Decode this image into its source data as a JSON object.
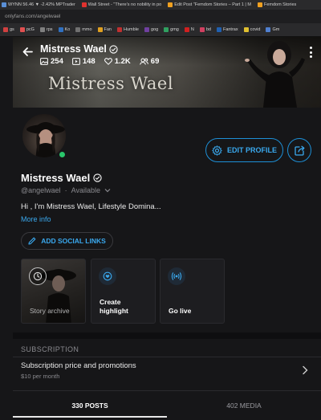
{
  "browser": {
    "tabs": [
      {
        "label": "WYNN 56.46 ▼ -2.42% MPTrader",
        "color": "#5a8fd6"
      },
      {
        "label": "Wall Street - \"There's no nobility in po",
        "color": "#e0322f"
      },
      {
        "label": "Edit Post \"Femdom Stories – Part 1 | M",
        "color": "#f0a020"
      },
      {
        "label": "Femdom Stories",
        "color": "#f0a020"
      }
    ],
    "url": "onlyfans.com/angelwael",
    "bookmarks": [
      {
        "label": "gs",
        "color": "#d04040"
      },
      {
        "label": "pcG",
        "color": "#e05050"
      },
      {
        "label": "rps",
        "color": "#808080"
      },
      {
        "label": "Ko",
        "color": "#3070c0"
      },
      {
        "label": "mmo",
        "color": "#707070"
      },
      {
        "label": "Fan",
        "color": "#e0a020"
      },
      {
        "label": "Humble",
        "color": "#c03030"
      },
      {
        "label": "gog",
        "color": "#7040a0"
      },
      {
        "label": "gmg",
        "color": "#30a060"
      },
      {
        "label": "N",
        "color": "#d02020"
      },
      {
        "label": "bd",
        "color": "#d04060"
      },
      {
        "label": "Fantrax",
        "color": "#2060b0"
      },
      {
        "label": "covid",
        "color": "#e0c030"
      },
      {
        "label": "Gm",
        "color": "#5080d0"
      }
    ]
  },
  "profile": {
    "header_name": "Mistress Wael",
    "cover_text": "Mistress Wael",
    "stats": {
      "photos": "254",
      "videos": "148",
      "likes": "1.2K",
      "fans": "69"
    },
    "name": "Mistress Wael",
    "handle": "@angelwael",
    "availability": "Available",
    "bio": "Hi , I'm Mistress Wael, Lifestyle Domina...",
    "more_info": "More info",
    "edit_profile": "EDIT PROFILE",
    "add_social": "ADD SOCIAL LINKS"
  },
  "highlights": {
    "archive": "Story archive",
    "create": "Create highlight",
    "live": "Go live"
  },
  "subscription": {
    "heading": "SUBSCRIPTION",
    "title": "Subscription price and promotions",
    "price": "$10 per month"
  },
  "tabs": {
    "posts": "330 POSTS",
    "media": "402 MEDIA"
  },
  "colors": {
    "accent": "#1d8fd6",
    "online": "#29c66b",
    "background": "#161618"
  }
}
